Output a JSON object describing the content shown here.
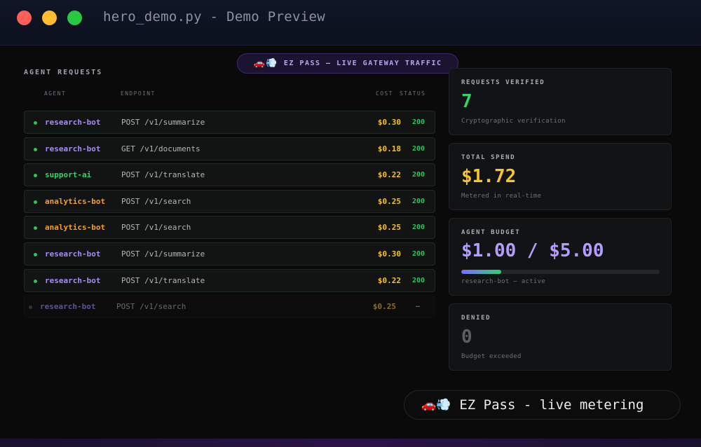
{
  "window": {
    "title": "hero_demo.py - Demo Preview"
  },
  "banner": {
    "icon": "🚗💨",
    "text": "EZ PASS — LIVE GATEWAY TRAFFIC"
  },
  "requests": {
    "title": "AGENT REQUESTS",
    "columns": {
      "agent": "AGENT",
      "endpoint": "ENDPOINT",
      "cost": "COST",
      "status": "STATUS"
    },
    "rows": [
      {
        "agent": "research-bot",
        "endpoint": "POST /v1/summarize",
        "cost": "$0.30",
        "status": "200",
        "color": "#a78bfa"
      },
      {
        "agent": "research-bot",
        "endpoint": "GET /v1/documents",
        "cost": "$0.18",
        "status": "200",
        "color": "#a78bfa"
      },
      {
        "agent": "support-ai",
        "endpoint": "POST /v1/translate",
        "cost": "$0.22",
        "status": "200",
        "color": "#35d26a"
      },
      {
        "agent": "analytics-bot",
        "endpoint": "POST /v1/search",
        "cost": "$0.25",
        "status": "200",
        "color": "#f59e2b"
      },
      {
        "agent": "analytics-bot",
        "endpoint": "POST /v1/search",
        "cost": "$0.25",
        "status": "200",
        "color": "#f59e2b"
      },
      {
        "agent": "research-bot",
        "endpoint": "POST /v1/summarize",
        "cost": "$0.30",
        "status": "200",
        "color": "#a78bfa"
      },
      {
        "agent": "research-bot",
        "endpoint": "POST /v1/translate",
        "cost": "$0.22",
        "status": "200",
        "color": "#a78bfa"
      },
      {
        "agent": "research-bot",
        "endpoint": "POST /v1/search",
        "cost": "$0.25",
        "status": "—",
        "color": "#a78bfa",
        "pending": true
      }
    ]
  },
  "stats": {
    "verified": {
      "label": "REQUESTS VERIFIED",
      "value": "7",
      "sub": "Cryptographic verification",
      "color": "#35d26a"
    },
    "spend": {
      "label": "TOTAL SPEND",
      "value": "$1.72",
      "sub": "Metered in real-time",
      "color": "#f5c531"
    },
    "budget": {
      "label": "AGENT BUDGET",
      "value": "$1.00 / $5.00",
      "sub": "research-bot — active",
      "color": "#b39dff",
      "fraction": 0.2
    },
    "denied": {
      "label": "DENIED",
      "value": "0",
      "sub": "Budget exceeded",
      "color": "#5b5e63"
    }
  },
  "toast": {
    "icon": "🚗💨",
    "text": "EZ Pass - live metering"
  }
}
